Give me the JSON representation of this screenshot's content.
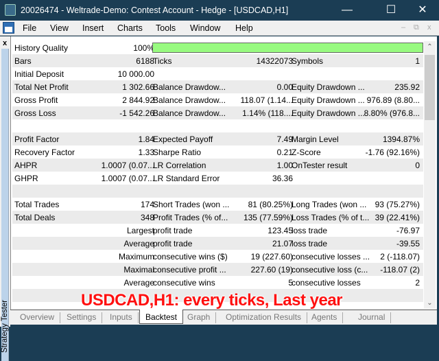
{
  "window": {
    "title": "20026474 - Weltrade-Demo: Contest Account - Hedge - [USDCAD,H1]"
  },
  "menu": [
    "File",
    "View",
    "Insert",
    "Charts",
    "Tools",
    "Window",
    "Help"
  ],
  "sidebar": {
    "close": "x",
    "label": "Strategy Tester"
  },
  "history_quality": {
    "label": "History Quality",
    "value": "100%",
    "fraction": 1.0,
    "color": "#98fa80"
  },
  "rows": [
    [
      "Bars",
      "6188",
      "Ticks",
      "14322073",
      "Symbols",
      "1"
    ],
    [
      "Initial Deposit",
      "10 000.00",
      "",
      "",
      "",
      ""
    ],
    [
      "Total Net Profit",
      "1 302.66",
      "Balance Drawdow...",
      "0.00",
      "Equity Drawdown ...",
      "235.92"
    ],
    [
      "Gross Profit",
      "2 844.92",
      "Balance Drawdow...",
      "118.07 (1.14...",
      "Equity Drawdown ...",
      "976.89 (8.80..."
    ],
    [
      "Gross Loss",
      "-1 542.26",
      "Balance Drawdow...",
      "1.14% (118....",
      "Equity Drawdown ...",
      "8.80% (976.8..."
    ],
    [
      "",
      "",
      "",
      "",
      "",
      ""
    ],
    [
      "Profit Factor",
      "1.84",
      "Expected Payoff",
      "7.49",
      "Margin Level",
      "1394.87%"
    ],
    [
      "Recovery Factor",
      "1.33",
      "Sharpe Ratio",
      "0.21",
      "Z-Score",
      "-1.76 (92.16%)"
    ],
    [
      "AHPR",
      "1.0007 (0.07...",
      "LR Correlation",
      "1.00",
      "OnTester result",
      "0"
    ],
    [
      "GHPR",
      "1.0007 (0.07...",
      "LR Standard Error",
      "36.36",
      "",
      ""
    ],
    [
      "",
      "",
      "",
      "",
      "",
      ""
    ],
    [
      "Total Trades",
      "174",
      "Short Trades (won ...",
      "81 (80.25%)",
      "Long Trades (won ...",
      "93 (75.27%)"
    ],
    [
      "Total Deals",
      "348",
      "Profit Trades (% of...",
      "135 (77.59%)",
      "Loss Trades (% of t...",
      "39 (22.41%)"
    ],
    [
      "",
      "Largest",
      "profit trade",
      "123.45",
      "loss trade",
      "-76.97"
    ],
    [
      "",
      "Average",
      "profit trade",
      "21.07",
      "loss trade",
      "-39.55"
    ],
    [
      "",
      "Maximum",
      "consecutive wins ($)",
      "19 (227.60)",
      "consecutive losses ...",
      "2 (-118.07)"
    ],
    [
      "",
      "Maximal",
      "consecutive profit ...",
      "227.60 (19)",
      "consecutive loss (c...",
      "-118.07 (2)"
    ],
    [
      "",
      "Average",
      "consecutive wins",
      "5",
      "consecutive losses",
      "2"
    ],
    [
      "",
      "",
      "",
      "",
      "",
      ""
    ],
    [
      "",
      "",
      "",
      "",
      "",
      ""
    ]
  ],
  "overlay": "USDCAD,H1: every ticks, Last year",
  "tabs": [
    "Overview",
    "Settings",
    "Inputs",
    "Backtest",
    "Graph",
    "Optimization Results",
    "Agents",
    "Journal"
  ],
  "active_tab": "Backtest"
}
